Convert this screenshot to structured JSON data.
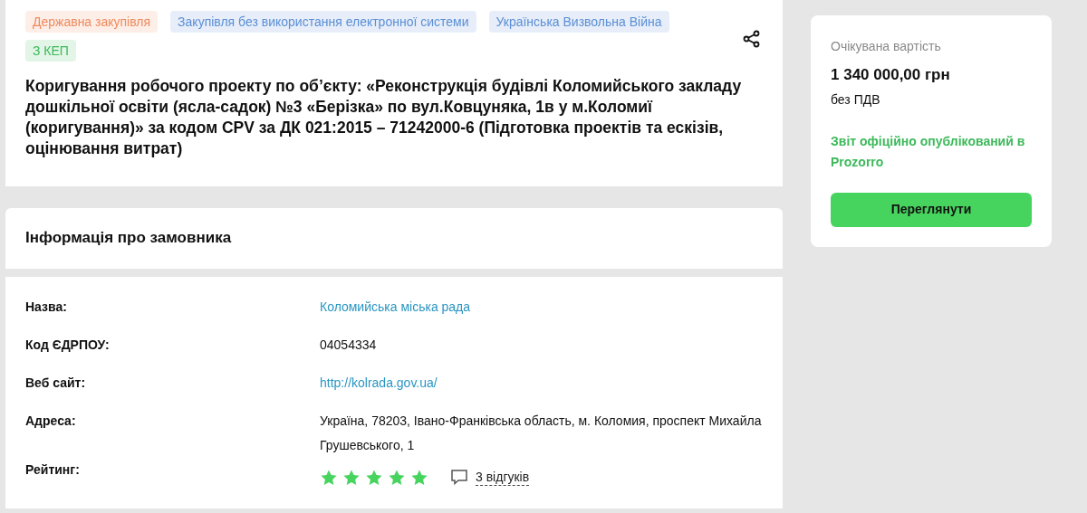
{
  "tags": [
    {
      "label": "Державна закупівля",
      "color": "#f08a5d"
    },
    {
      "label": "Закупівля без використання електронної системи",
      "color": "#5b8fd6"
    },
    {
      "label": "Українська Визвольна Війна",
      "color": "#5b8fd6"
    },
    {
      "label": "З КЕП",
      "color": "#3cb95a"
    }
  ],
  "title": "Коригування робочого проекту по об’єкту: «Реконструкція будівлі Коломийського закладу дошкільної освіти (ясла-садок) №3 «Берізка» по вул.Ковцуняка, 1в у м.Коломиї (коригування)» за кодом CPV за ДК 021:2015 – 71242000-6 (Підготовка проектів та ескізів, оцінювання витрат)",
  "customer": {
    "heading": "Інформація про замовника",
    "rows": [
      {
        "kind": "link",
        "label": "Назва:",
        "value": "Коломийська міська рада"
      },
      {
        "kind": "text",
        "label": "Код ЄДРПОУ:",
        "value": "04054334"
      },
      {
        "kind": "link",
        "label": "Веб сайт:",
        "value": "http://kolrada.gov.ua/"
      },
      {
        "kind": "text",
        "label": "Адреса:",
        "value": "Україна, 78203, Івано-Франківська область, м. Коломия, проспект Михайла Грушевського, 1"
      },
      {
        "kind": "rating",
        "label": "Рейтинг:",
        "stars": 5,
        "reviews": "3 відгуків"
      }
    ]
  },
  "price": {
    "label": "Очікувана вартість",
    "amount": "1 340 000,00 грн",
    "vat": "без ПДВ",
    "status": "Звіт офіційно опублікований в Prozorro",
    "button": "Переглянути"
  }
}
